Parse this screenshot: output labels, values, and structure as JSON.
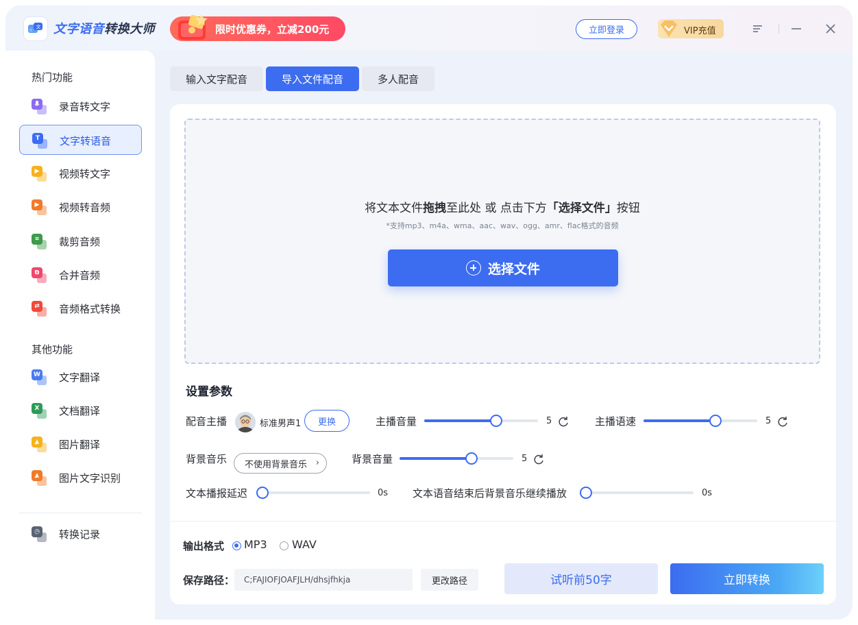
{
  "app": {
    "title_highlight": "文字语音",
    "title_rest": "转换大师",
    "promo_text": "限时优惠券，立减200元",
    "login_label": "立即登录",
    "vip_label": "VIP充值"
  },
  "sidebar": {
    "section_hot": "热门功能",
    "section_other": "其他功能",
    "items": [
      {
        "label": "录音转文字",
        "icon": "microphone-icon",
        "color": "#8a6cf0",
        "glyph": ""
      },
      {
        "label": "文字转语音",
        "icon": "text-t-icon",
        "color": "#3c6cf0",
        "glyph": "T"
      },
      {
        "label": "视频转文字",
        "icon": "play-icon",
        "color": "#f6b21b",
        "glyph": "▶"
      },
      {
        "label": "视频转音频",
        "icon": "play-icon",
        "color": "#f07a2a",
        "glyph": "▶"
      },
      {
        "label": "裁剪音频",
        "icon": "crop-icon",
        "color": "#3f9a4a",
        "glyph": "⌗"
      },
      {
        "label": "合并音频",
        "icon": "merge-icon",
        "color": "#f0476a",
        "glyph": "⧉"
      },
      {
        "label": "音频格式转换",
        "icon": "convert-icon",
        "color": "#f04a3a",
        "glyph": "⇄"
      },
      {
        "label": "文字翻译",
        "icon": "word-w-icon",
        "color": "#4a7cf0",
        "glyph": "W"
      },
      {
        "label": "文档翻译",
        "icon": "excel-x-icon",
        "color": "#2f9a58",
        "glyph": "X"
      },
      {
        "label": "图片翻译",
        "icon": "image-icon",
        "color": "#f6b21b",
        "glyph": "▲"
      },
      {
        "label": "图片文字识别",
        "icon": "image-icon",
        "color": "#f07a2a",
        "glyph": "▲"
      },
      {
        "label": "转换记录",
        "icon": "history-icon",
        "color": "#5a6275",
        "glyph": "◷"
      }
    ]
  },
  "tabs": [
    {
      "label": "输入文字配音"
    },
    {
      "label": "导入文件配音"
    },
    {
      "label": "多人配音"
    }
  ],
  "dropzone": {
    "title_p1": "将文本文件",
    "title_b1": "拖拽",
    "title_p2": "至此处 或 点击下方",
    "title_b2": "「选择文件」",
    "title_p3": "按钮",
    "subtitle": "*支持mp3、m4a、wma、aac、wav、ogg、amr、flac格式的音频",
    "button_label": "选择文件"
  },
  "settings": {
    "title": "设置参数",
    "voice_label": "配音主播",
    "voice_name": "标准男声1",
    "change_label": "更换",
    "anchor_volume_label": "主播音量",
    "anchor_volume_value": "5",
    "anchor_volume_fraction": 0.65,
    "anchor_speed_label": "主播语速",
    "anchor_speed_value": "5",
    "anchor_speed_fraction": 0.65,
    "bgm_label": "背景音乐",
    "bgm_value": "不使用背景音乐",
    "bgm_volume_label": "背景音量",
    "bgm_volume_value": "5",
    "bgm_volume_fraction": 0.65,
    "delay_label": "文本播报延迟",
    "delay_value": "0s",
    "delay_fraction": 0,
    "continue_label": "文本语音结束后背景音乐继续播放",
    "continue_value": "0s",
    "continue_fraction": 0
  },
  "output": {
    "format_label": "输出格式",
    "formats": [
      {
        "label": "MP3",
        "selected": true
      },
      {
        "label": "WAV",
        "selected": false
      }
    ],
    "path_label": "保存路径：",
    "path_value": "C;FAJIOFJOAFJLH/dhsjfhkja",
    "change_path_label": "更改路径",
    "preview_label": "试听前50字",
    "convert_label": "立即转换"
  },
  "colors": {
    "accent": "#3c6cf0",
    "promo": "#ff4a64",
    "vip": "#f7d79e"
  }
}
